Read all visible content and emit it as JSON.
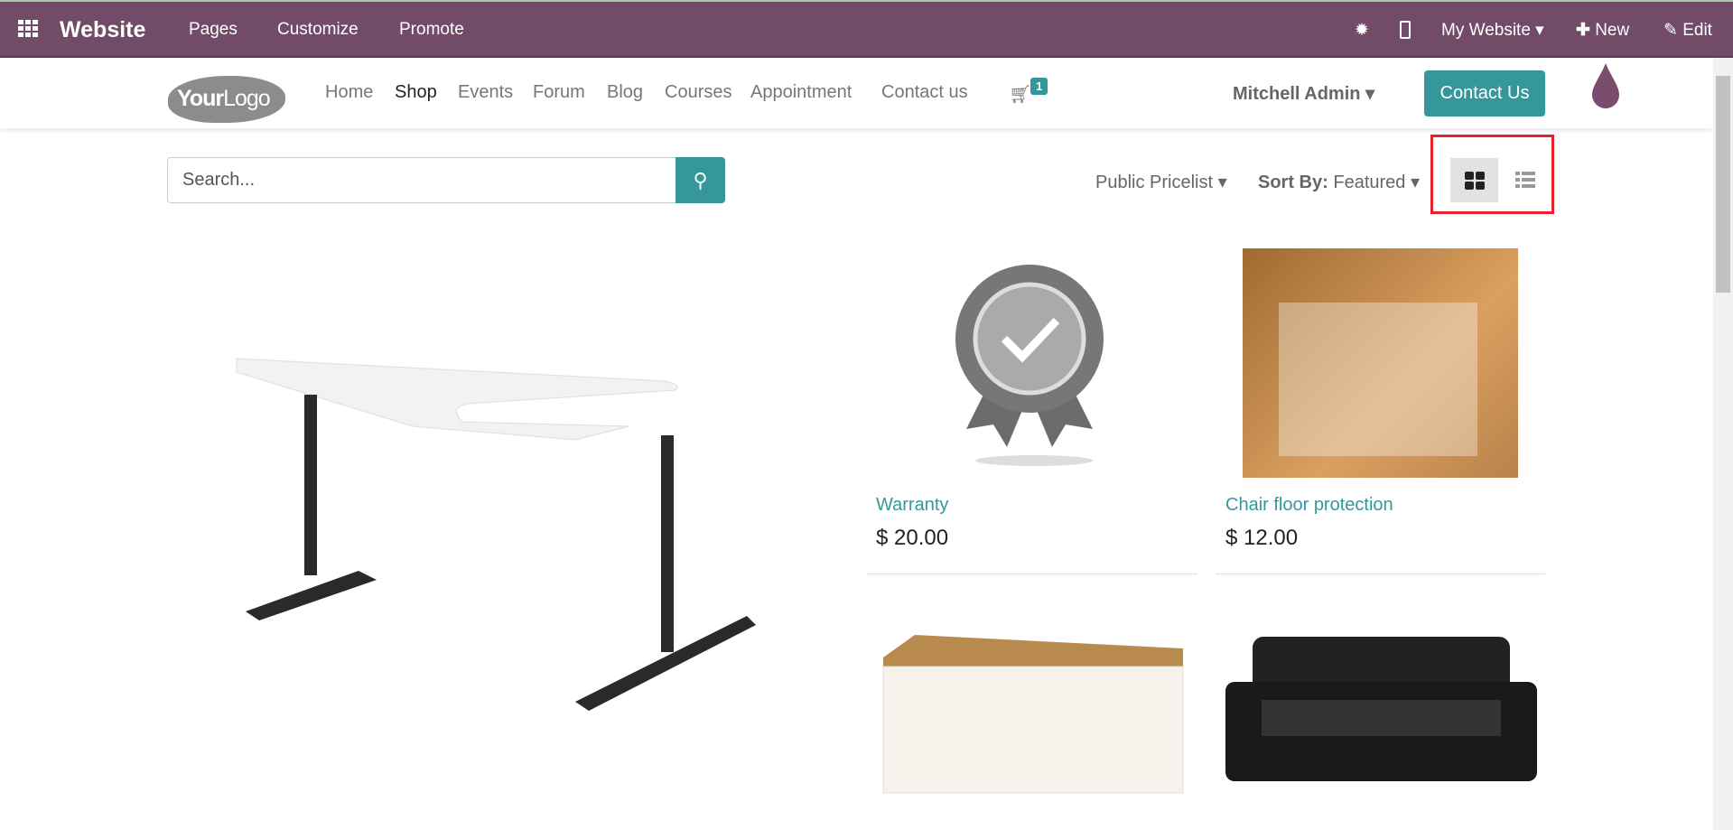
{
  "topbar": {
    "app": "Website",
    "menu": [
      "Pages",
      "Customize",
      "Promote"
    ],
    "my_website": "My Website",
    "new": "New",
    "edit": "Edit",
    "color": "#714b67"
  },
  "nav": {
    "logo": "YourLogo",
    "links": [
      "Home",
      "Shop",
      "Events",
      "Forum",
      "Blog",
      "Courses",
      "Appointment",
      "Contact us"
    ],
    "active": "Shop",
    "cart_count": "1",
    "user": "Mitchell Admin",
    "contact_button": "Contact Us",
    "accent": "#35979c"
  },
  "toolbar": {
    "search_placeholder": "Search...",
    "pricelist": "Public Pricelist",
    "sort_label": "Sort By:",
    "sort_value": "Featured",
    "view": "grid"
  },
  "products": [
    {
      "name": "Warranty",
      "price": "$ 20.00"
    },
    {
      "name": "Chair floor protection",
      "price": "$ 12.00"
    }
  ]
}
